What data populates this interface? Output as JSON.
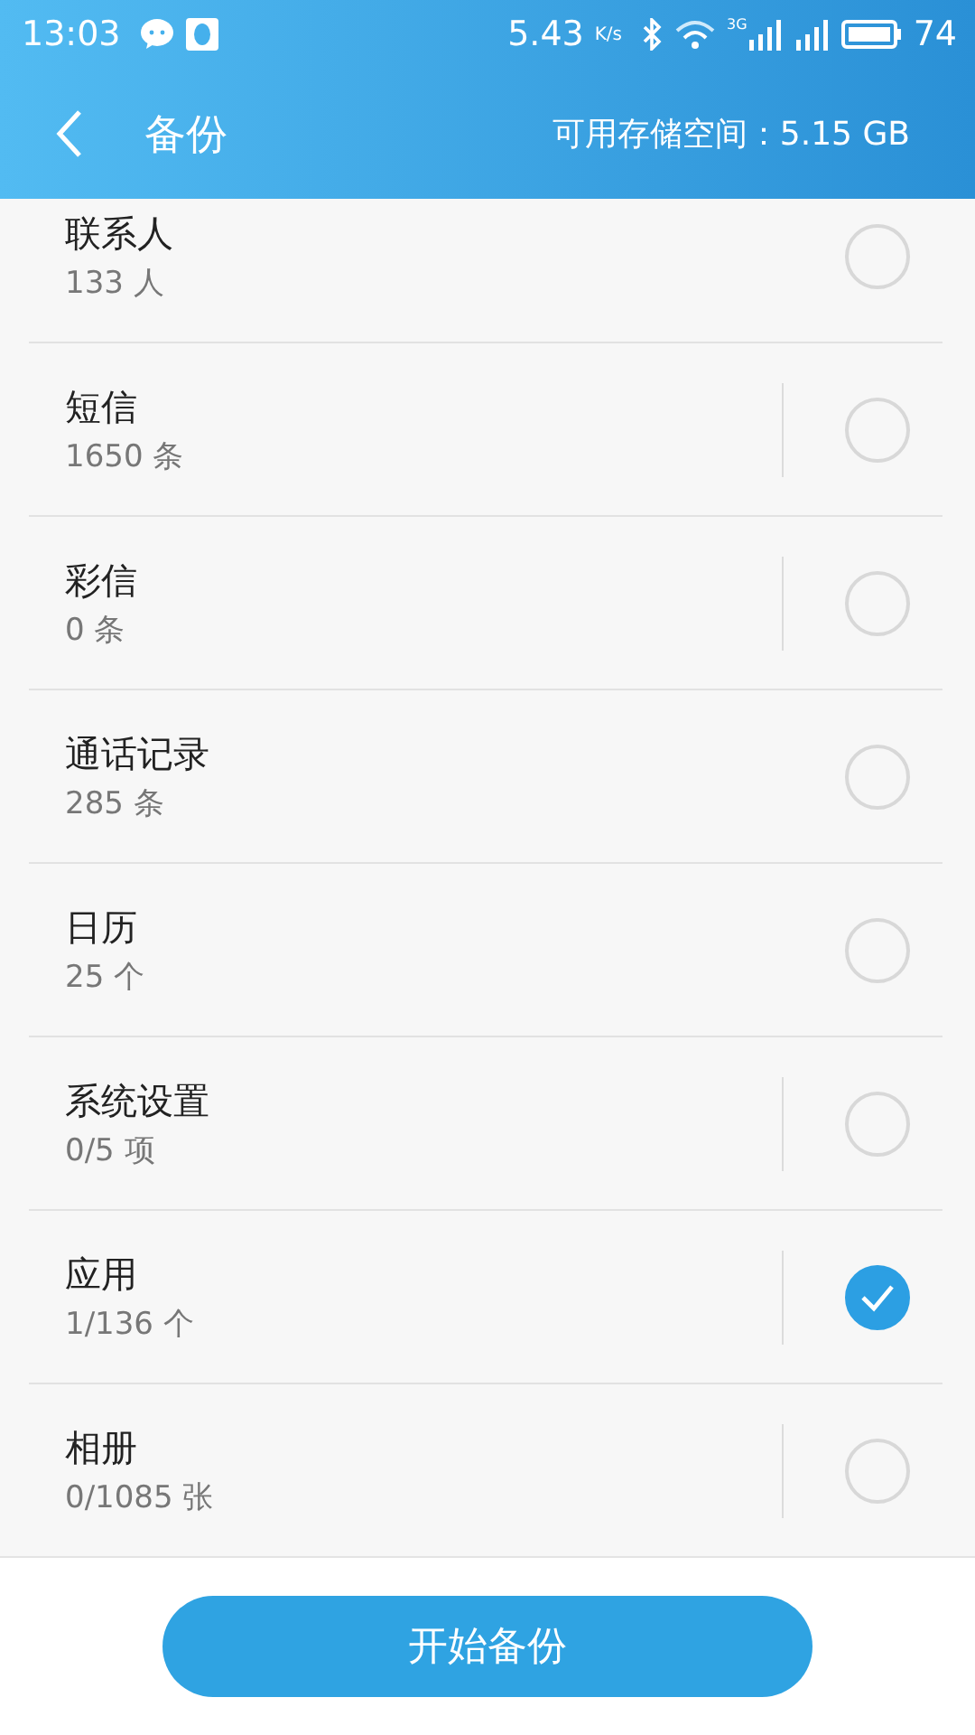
{
  "status_bar": {
    "time": "13:03",
    "speed": "5.43",
    "speed_unit": "K/s",
    "network": "3G",
    "battery": "74"
  },
  "header": {
    "title": "备份",
    "storage": "可用存储空间：5.15 GB"
  },
  "items": [
    {
      "name": "联系人",
      "count": "133 人",
      "expandable": false,
      "checked": false
    },
    {
      "name": "短信",
      "count": "1650 条",
      "expandable": true,
      "checked": false
    },
    {
      "name": "彩信",
      "count": "0 条",
      "expandable": true,
      "checked": false
    },
    {
      "name": "通话记录",
      "count": "285 条",
      "expandable": false,
      "checked": false
    },
    {
      "name": "日历",
      "count": "25 个",
      "expandable": false,
      "checked": false
    },
    {
      "name": "系统设置",
      "count": "0/5 项",
      "expandable": true,
      "checked": false
    },
    {
      "name": "应用",
      "count": "1/136 个",
      "expandable": true,
      "checked": true
    },
    {
      "name": "相册",
      "count": "0/1085 张",
      "expandable": true,
      "checked": false
    }
  ],
  "start_button": "开始备份"
}
